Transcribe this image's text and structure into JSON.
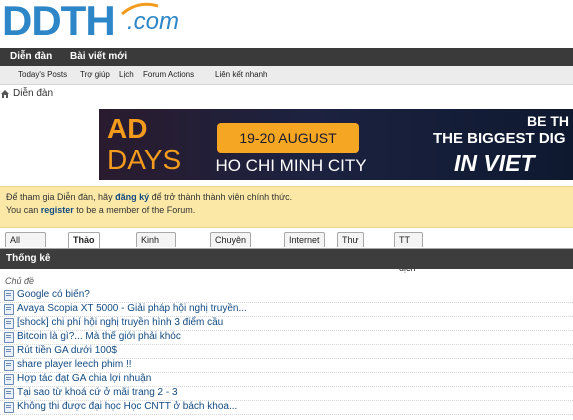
{
  "logo": {
    "main": "DDTH",
    "suffix": ".com"
  },
  "navbar": {
    "items": [
      "Diễn đàn",
      "Bài viết mới"
    ]
  },
  "subnav": {
    "items": [
      "Today's Posts",
      "Trợ giúp",
      "Lịch",
      "Forum Actions",
      "Liên kết nhanh"
    ]
  },
  "breadcrumb": {
    "label": "Diễn đàn"
  },
  "banner": {
    "ad": "AD",
    "days": "DAYS",
    "date": "19-20 AUGUST",
    "city": "HO CHI MINH CITY",
    "line1": "BE TH",
    "line2": "THE BIGGEST DIG",
    "line3": "IN VIET",
    "colors": {
      "accent": "#f5a623",
      "background": "#1c2240"
    }
  },
  "notice": {
    "line1_pre": "Để tham gia Diễn đàn, hãy ",
    "line1_link": "đăng ký",
    "line1_post": " để trở thành thành viên chính thức.",
    "line2_pre": "You can ",
    "line2_link": "register",
    "line2_post": " to be a member of the Forum."
  },
  "tabs": [
    "All Forums",
    "Thảo luận",
    "Kinh nghiệm",
    "Chuyên môn",
    "Internet",
    "Thư giãn",
    "TT Giao dịch"
  ],
  "active_tab": "Thảo luận",
  "stats": {
    "title": "Thống kê",
    "column_label": "Chủ đề"
  },
  "threads": [
    "Google có biến?",
    "Avaya Scopia XT 5000 - Giải pháp hội nghị truyền...",
    "[shock] chi phí hội nghị truyền hình 3 điểm cầu",
    "Bitcoin là gì?... Mà thế giới phải khóc",
    "Rút tiền GA dưới 100$",
    "share player leech phim !!",
    "Hợp tác đạt GA chia lợi nhuận",
    "Tại sao từ khoá cứ ở mãi trang 2 - 3",
    "Không thi được đại học Học CNTT ở bách khoa..."
  ],
  "icons": [
    "home-icon",
    "thread-icon"
  ],
  "colors": {
    "nav": "#3a3a3a",
    "link": "#134b82",
    "notice": "#fbe8a6",
    "brand": "#2d86c7"
  }
}
